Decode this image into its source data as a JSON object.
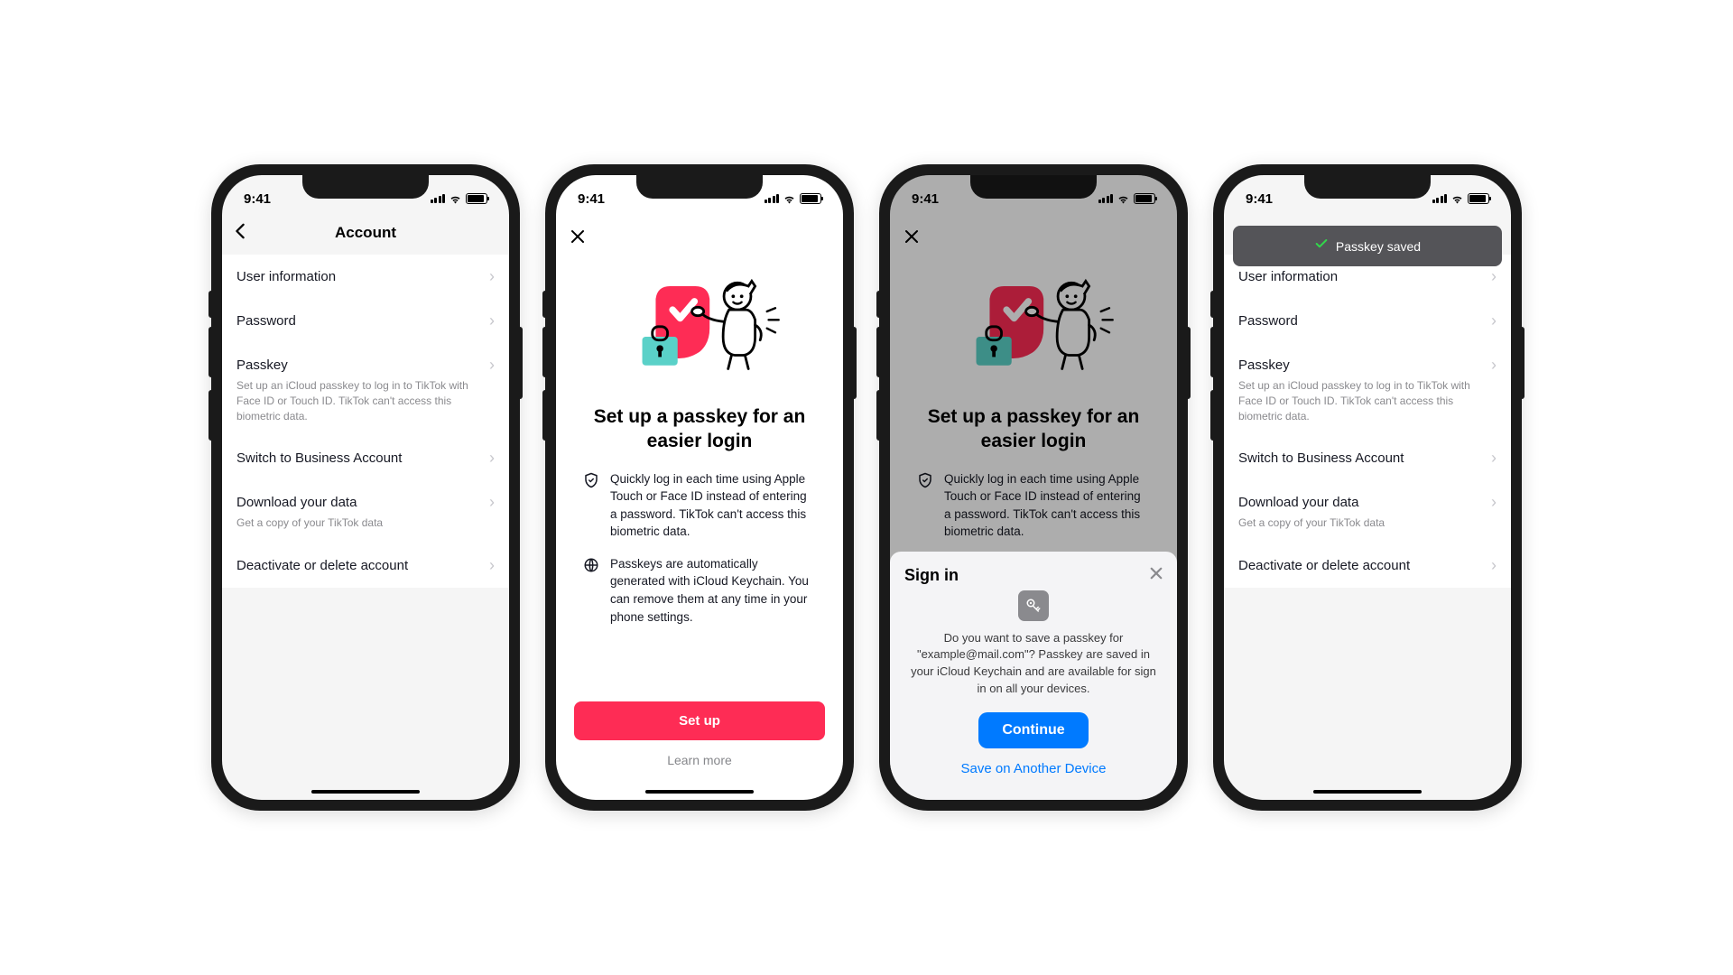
{
  "status": {
    "time": "9:41"
  },
  "account": {
    "title": "Account",
    "items": [
      {
        "label": "User information"
      },
      {
        "label": "Password"
      },
      {
        "label": "Passkey",
        "sub": "Set up an iCloud passkey to log in to TikTok with Face ID or Touch ID. TikTok can't access this biometric data."
      },
      {
        "label": "Switch to Business Account"
      },
      {
        "label": "Download your data",
        "sub": "Get a copy of your TikTok data"
      },
      {
        "label": "Deactivate or delete account"
      }
    ]
  },
  "setup": {
    "title": "Set up a passkey for an easier login",
    "feature1": "Quickly log in each time using Apple Touch or Face ID instead of entering a password. TikTok can't access this biometric data.",
    "feature2": "Passkeys are automatically generated with iCloud Keychain. You can remove them at any time in your phone settings.",
    "primary": "Set up",
    "secondary": "Learn more"
  },
  "sheet": {
    "title": "Sign in",
    "body": "Do you want to save a passkey for \"example@mail.com\"? Passkey are saved in your iCloud Keychain and are available for sign in on all your devices.",
    "continue": "Continue",
    "alt": "Save on Another Device"
  },
  "toast": {
    "text": "Passkey saved"
  }
}
